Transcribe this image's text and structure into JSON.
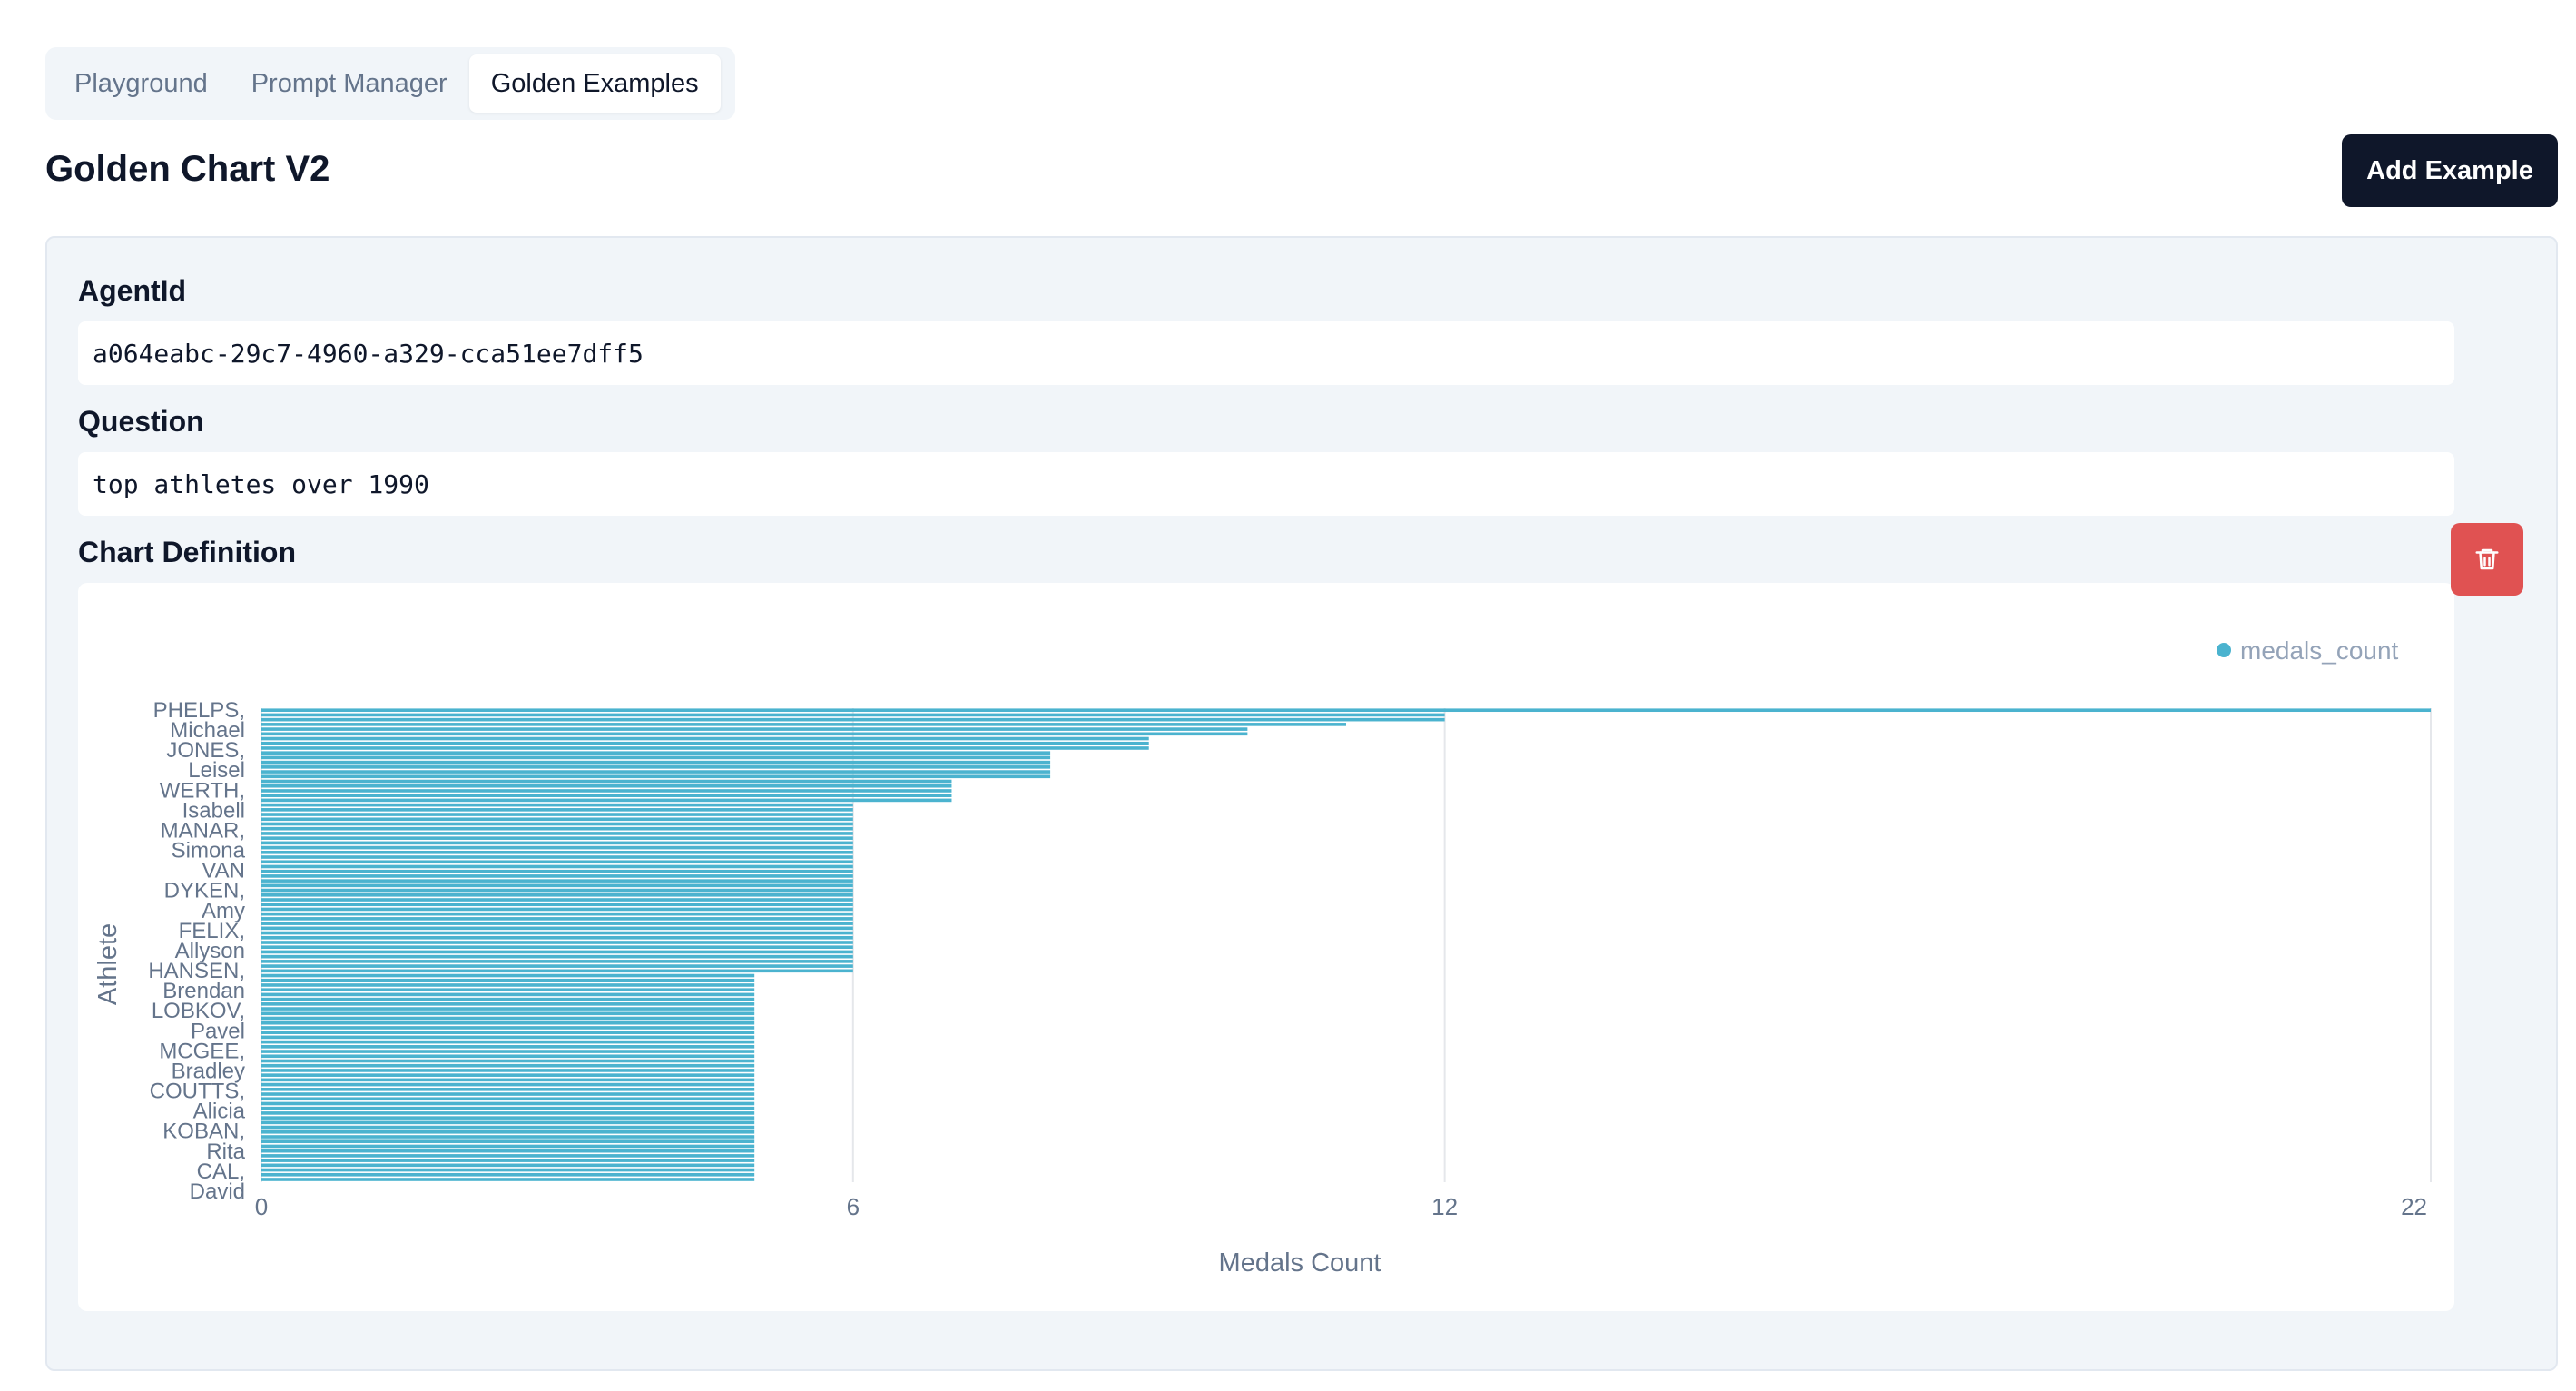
{
  "tabs": [
    {
      "label": "Playground",
      "active": false
    },
    {
      "label": "Prompt Manager",
      "active": false
    },
    {
      "label": "Golden Examples",
      "active": true
    }
  ],
  "page": {
    "title": "Golden Chart V2",
    "add_button_label": "Add Example"
  },
  "example": {
    "agent_id_label": "AgentId",
    "agent_id_value": "a064eabc-29c7-4960-a329-cca51ee7dff5",
    "question_label": "Question",
    "question_value": "top athletes over 1990",
    "chart_definition_label": "Chart Definition"
  },
  "icons": {
    "delete": "trash-icon"
  },
  "colors": {
    "bar": "#4bb3cf",
    "primary_button": "#0f172a",
    "danger_button": "#e05252"
  },
  "chart_data": {
    "type": "bar",
    "orientation": "horizontal",
    "xlabel": "Medals Count",
    "ylabel": "Athlete",
    "xlim": [
      0,
      22
    ],
    "x_ticks": [
      0,
      6,
      12,
      22
    ],
    "legend": [
      "medals_count"
    ],
    "legend_position": "top-right",
    "grid": true,
    "tick_labels": [
      "PHELPS,",
      "Michael",
      "JONES,",
      "Leisel",
      "WERTH,",
      "Isabell",
      "MANAR,",
      "Simona",
      "VAN",
      "DYKEN,",
      "Amy",
      "FELIX,",
      "Allyson",
      "HANSEN,",
      "Brendan",
      "LOBKOV,",
      "Pavel",
      "MCGEE,",
      "Bradley",
      "COUTTS,",
      "Alicia",
      "KOBAN,",
      "Rita",
      "CAL,",
      "David"
    ],
    "series": [
      {
        "name": "medals_count",
        "values": [
          22,
          12,
          12,
          11,
          10,
          10,
          9,
          9,
          9,
          8,
          8,
          8,
          8,
          8,
          8,
          7,
          7,
          7,
          7,
          7,
          6,
          6,
          6,
          6,
          6,
          6,
          6,
          6,
          6,
          6,
          6,
          6,
          6,
          6,
          6,
          6,
          6,
          6,
          6,
          6,
          6,
          6,
          6,
          6,
          6,
          6,
          6,
          6,
          6,
          6,
          6,
          6,
          6,
          6,
          6,
          6,
          5,
          5,
          5,
          5,
          5,
          5,
          5,
          5,
          5,
          5,
          5,
          5,
          5,
          5,
          5,
          5,
          5,
          5,
          5,
          5,
          5,
          5,
          5,
          5,
          5,
          5,
          5,
          5,
          5,
          5,
          5,
          5,
          5,
          5,
          5,
          5,
          5,
          5,
          5,
          5,
          5,
          5,
          5,
          5
        ]
      }
    ]
  }
}
